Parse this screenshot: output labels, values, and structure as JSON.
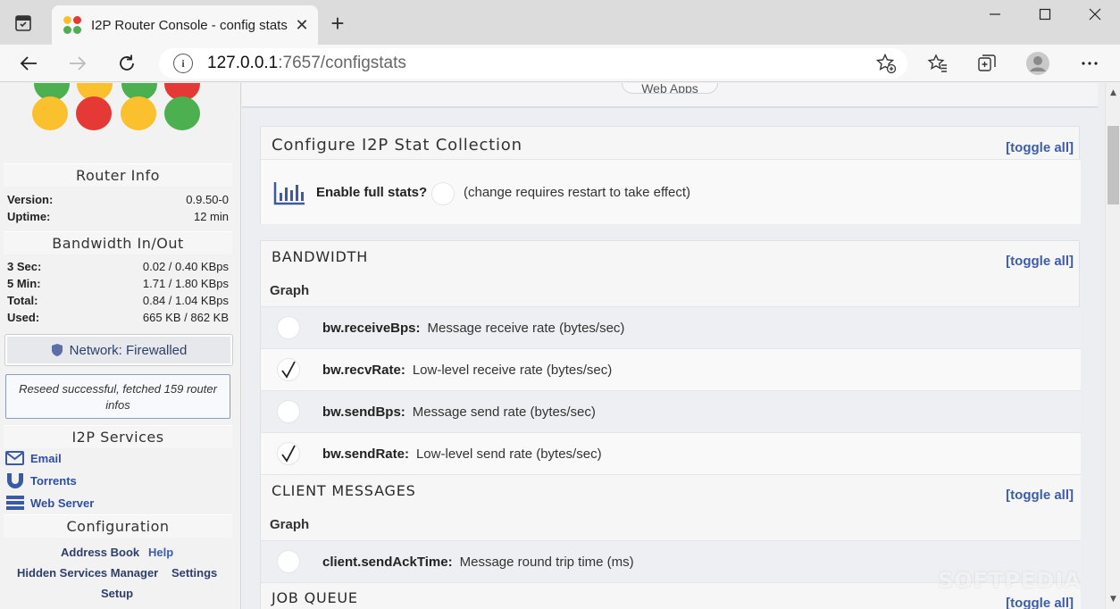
{
  "browser": {
    "tab_title": "I2P Router Console - config stats",
    "url_host": "127.0.0.1",
    "url_rest": ":7657/configstats",
    "new_tab_label": "+",
    "close_label": "✕"
  },
  "sidebar": {
    "router_info": {
      "title": "Router Info",
      "rows": [
        {
          "key": "Version:",
          "value": "0.9.50-0"
        },
        {
          "key": "Uptime:",
          "value": "12 min"
        }
      ]
    },
    "bandwidth": {
      "title": "Bandwidth In/Out",
      "rows": [
        {
          "key": "3 Sec:",
          "value": "0.02 / 0.40 KBps"
        },
        {
          "key": "5 Min:",
          "value": "1.71 / 1.80 KBps"
        },
        {
          "key": "Total:",
          "value": "0.84 / 1.04 KBps"
        },
        {
          "key": "Used:",
          "value": "665 KB / 862 KB"
        }
      ]
    },
    "network_status": "Network: Firewalled",
    "reseed_message": "Reseed successful, fetched 159 router infos",
    "services": {
      "title": "I2P Services",
      "items": [
        {
          "label": "Email",
          "icon": "email-icon"
        },
        {
          "label": "Torrents",
          "icon": "torrent-icon"
        },
        {
          "label": "Web Server",
          "icon": "server-icon"
        }
      ]
    },
    "configuration": {
      "title": "Configuration",
      "links": [
        "Address Book",
        "Help",
        "Hidden Services Manager",
        "Settings",
        "Setup"
      ]
    }
  },
  "main": {
    "top_tab": "Web Apps",
    "config_panel": {
      "title": "Configure I2P Stat Collection",
      "toggle_all": "[toggle all]",
      "full_stats_label": "Enable full stats?",
      "full_stats_note": "(change requires restart to take effect)",
      "full_stats_checked": false
    },
    "sections": [
      {
        "title": "BANDWIDTH",
        "toggle_all": "[toggle all]",
        "graph_label": "Graph",
        "stats": [
          {
            "name": "bw.receiveBps:",
            "desc": "Message receive rate (bytes/sec)",
            "checked": false
          },
          {
            "name": "bw.recvRate:",
            "desc": "Low-level receive rate (bytes/sec)",
            "checked": true
          },
          {
            "name": "bw.sendBps:",
            "desc": "Message send rate (bytes/sec)",
            "checked": false
          },
          {
            "name": "bw.sendRate:",
            "desc": "Low-level send rate (bytes/sec)",
            "checked": true
          }
        ]
      },
      {
        "title": "CLIENT MESSAGES",
        "toggle_all": "[toggle all]",
        "graph_label": "Graph",
        "stats": [
          {
            "name": "client.sendAckTime:",
            "desc": "Message round trip time (ms)",
            "checked": false
          }
        ]
      },
      {
        "title": "JOB QUEUE",
        "toggle_all": "[toggle all]"
      }
    ]
  },
  "watermark": "SOFTPEDIA",
  "colors": {
    "link_blue": "#3d5da8",
    "logo_green": "#4caf50",
    "logo_yellow": "#fbc02d",
    "logo_red": "#e53935",
    "status_navy": "#2d3f6b"
  }
}
